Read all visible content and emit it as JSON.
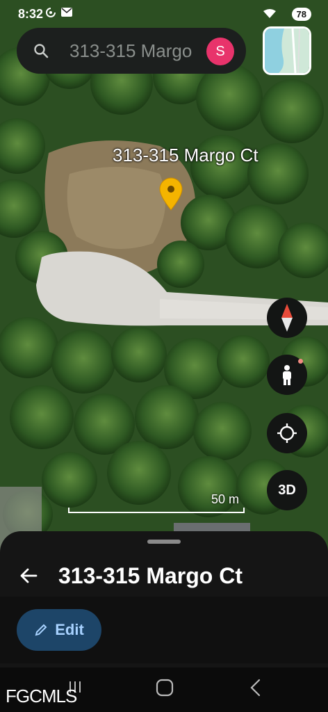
{
  "status_bar": {
    "time": "8:32",
    "battery": "78"
  },
  "search": {
    "text": "313-315 Margo",
    "avatar_letter": "S"
  },
  "map": {
    "place_label": "313-315 Margo Ct",
    "scale_label": "50 m"
  },
  "fabs": {
    "three_d": "3D"
  },
  "sheet": {
    "title": "313-315 Margo Ct",
    "edit_label": "Edit"
  },
  "watermark": "FGCMLS",
  "icons": [
    "search-icon",
    "layers-icon",
    "location-pin-icon",
    "compass-icon",
    "pegman-icon",
    "my-location-icon",
    "back-arrow-icon",
    "pencil-icon",
    "recents-icon",
    "home-icon",
    "nav-back-icon",
    "wifi-icon",
    "signal-icon",
    "mail-icon"
  ],
  "colors": {
    "avatar": "#e8336b",
    "pin": "#f4b400",
    "edit_bg": "#1d4568",
    "edit_text": "#a8d2ff"
  }
}
